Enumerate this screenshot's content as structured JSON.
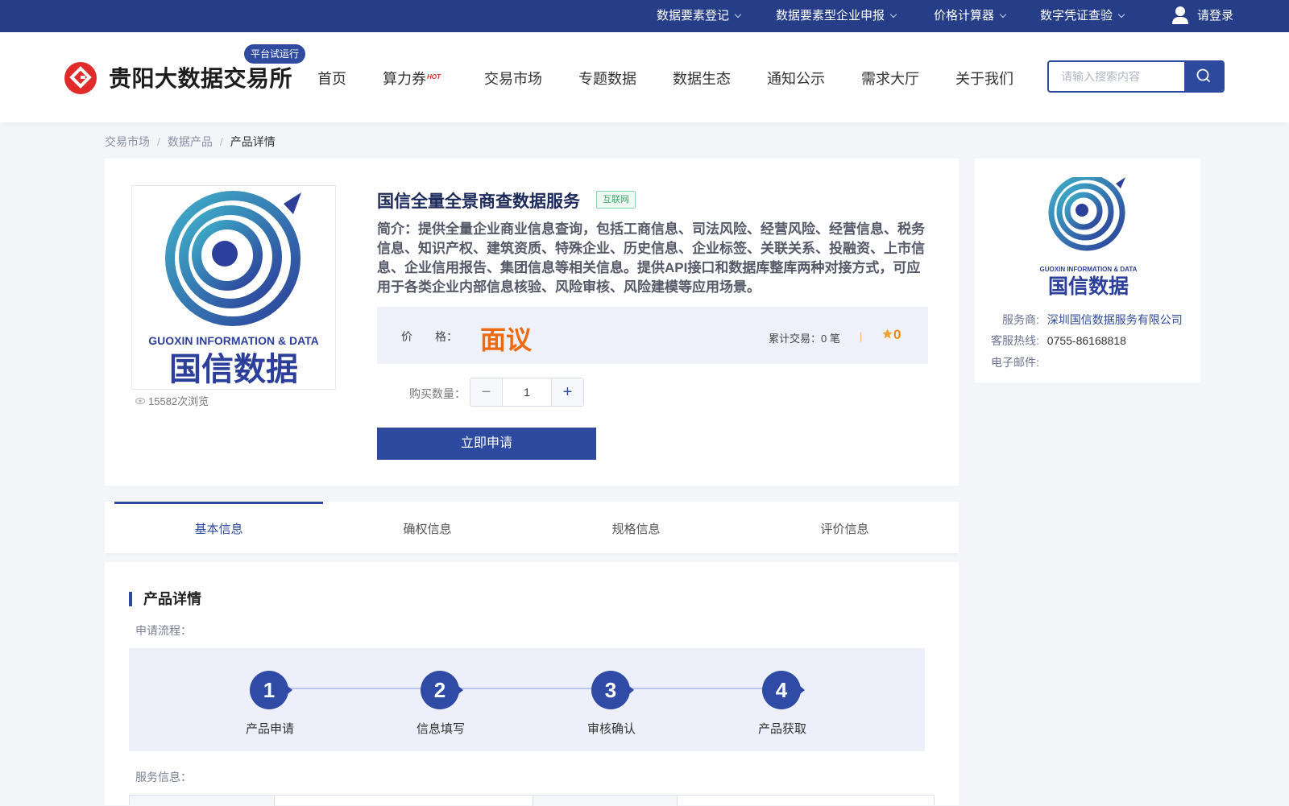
{
  "topbar": {
    "items": [
      "数据要素登记",
      "数据要素型企业申报",
      "价格计算器",
      "数字凭证查验"
    ],
    "login": "请登录"
  },
  "header": {
    "logo_text": "贵阳大数据交易所",
    "badge": "平台试运行",
    "nav": [
      "首页",
      "算力券",
      "交易市场",
      "专题数据",
      "数据生态",
      "通知公示",
      "需求大厅",
      "关于我们"
    ],
    "hot_label": "HOT",
    "search_placeholder": "请输入搜索内容"
  },
  "breadcrumb": [
    "交易市场",
    "数据产品",
    "产品详情"
  ],
  "product": {
    "title": "国信全量全景商查数据服务",
    "tag": "互联网",
    "intro": "简介：提供全量企业商业信息查询，包括工商信息、司法风险、经营风险、经营信息、税务信息、知识产权、建筑资质、特殊企业、历史信息、企业标签、关联关系、投融资、上市信息、企业信用报告、集团信息等相关信息。提供API接口和数据库整库两种对接方式，可应用于各类企业内部信息核验、风险审核、风险建模等应用场景。",
    "price_label": "价　　格：",
    "price_value": "面议",
    "trade_count": "累计交易：0 笔",
    "divider": "|",
    "score": "0",
    "views": "15582次浏览",
    "qty_label": "购买数量：",
    "qty_value": "1",
    "apply_label": "立即申请",
    "logo_line1": "GUOXIN INFORMATION & DATA",
    "logo_line2": "国信数据"
  },
  "provider": {
    "service_key": "服务商:",
    "service_value": "深圳国信数据服务有限公司",
    "hotline_key": "客服热线:",
    "hotline_value": "0755-86168818",
    "email_key": "电子邮件:",
    "logo_line1": "GUOXIN INFORMATION & DATA",
    "logo_line2": "国信数据"
  },
  "tabs": [
    "基本信息",
    "确权信息",
    "规格信息",
    "评价信息"
  ],
  "detail": {
    "title": "产品详情",
    "flow_label": "申请流程：",
    "steps": [
      {
        "num": "1",
        "label": "产品申请"
      },
      {
        "num": "2",
        "label": "信息填写"
      },
      {
        "num": "3",
        "label": "审核确认"
      },
      {
        "num": "4",
        "label": "产品获取"
      }
    ],
    "service_label": "服务信息："
  },
  "colors": {
    "primary": "#2d4a9e",
    "topbar": "#263d87",
    "price": "#ec6a12",
    "tag_green": "#38a86a"
  }
}
